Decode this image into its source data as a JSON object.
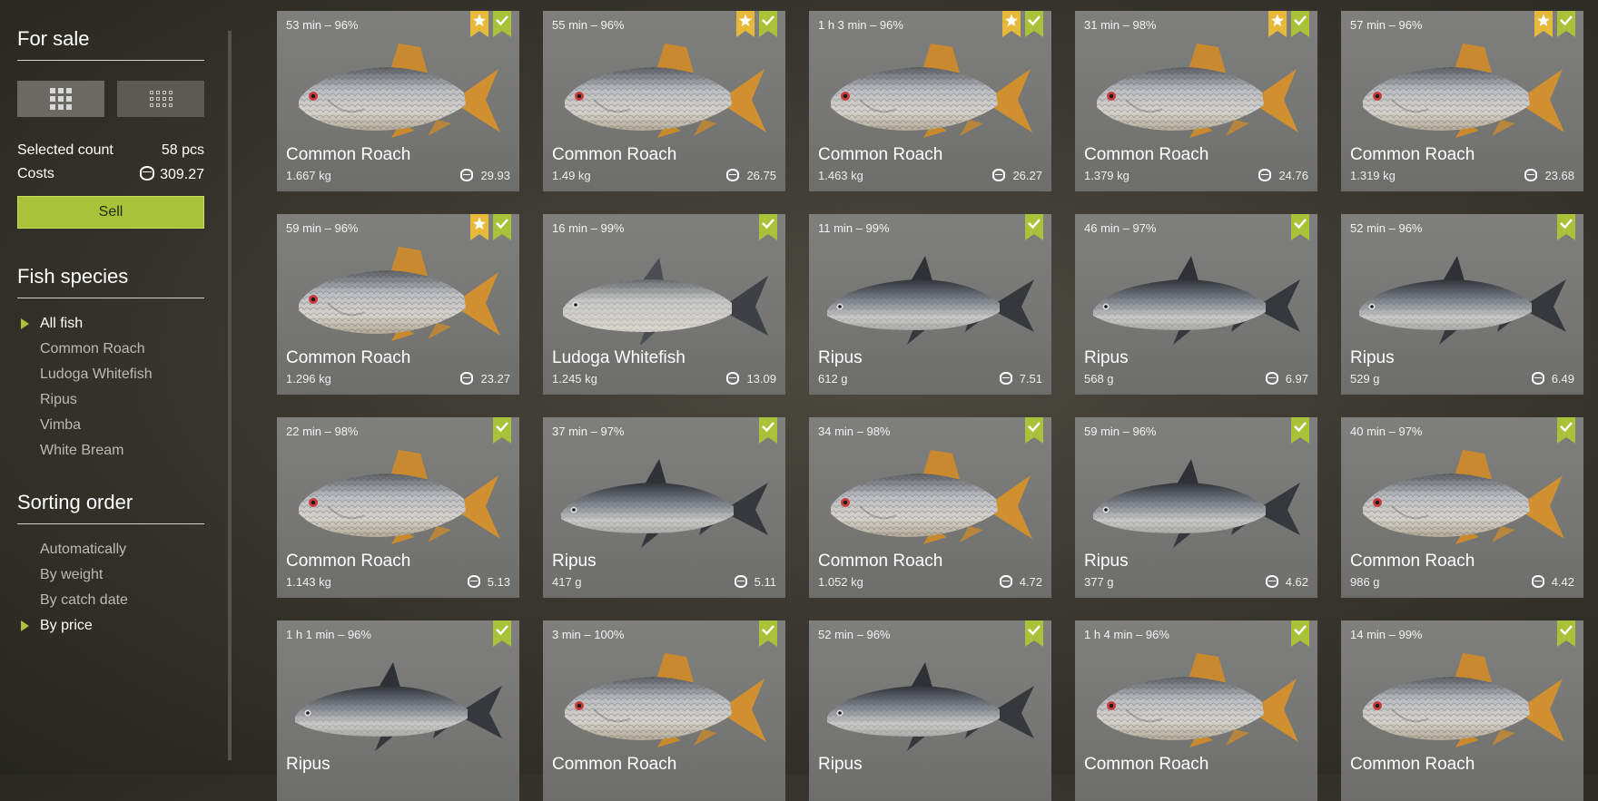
{
  "sidebar": {
    "for_sale_title": "For sale",
    "selected_count_label": "Selected count",
    "selected_count_value": "58 pcs",
    "costs_label": "Costs",
    "costs_value": "309.27",
    "sell_label": "Sell",
    "species_title": "Fish species",
    "species": [
      {
        "label": "All fish",
        "active": true
      },
      {
        "label": "Common Roach",
        "active": false
      },
      {
        "label": "Ludoga Whitefish",
        "active": false
      },
      {
        "label": "Ripus",
        "active": false
      },
      {
        "label": "Vimba",
        "active": false
      },
      {
        "label": "White Bream",
        "active": false
      }
    ],
    "sort_title": "Sorting order",
    "sorting": [
      {
        "label": "Automatically",
        "active": false
      },
      {
        "label": "By weight",
        "active": false
      },
      {
        "label": "By catch date",
        "active": false
      },
      {
        "label": "By price",
        "active": true
      }
    ]
  },
  "colors": {
    "accent": "#a9c23a",
    "star_ribbon": "#e6b93a",
    "card_bg": "#7a7a78"
  },
  "cards": [
    {
      "time": "53 min – 96%",
      "name": "Common Roach",
      "weight": "1.667 kg",
      "price": "29.93",
      "star": true,
      "fish": "roach"
    },
    {
      "time": "55 min – 96%",
      "name": "Common Roach",
      "weight": "1.49 kg",
      "price": "26.75",
      "star": true,
      "fish": "roach"
    },
    {
      "time": "1 h 3 min – 96%",
      "name": "Common Roach",
      "weight": "1.463 kg",
      "price": "26.27",
      "star": true,
      "fish": "roach"
    },
    {
      "time": "31 min – 98%",
      "name": "Common Roach",
      "weight": "1.379 kg",
      "price": "24.76",
      "star": true,
      "fish": "roach"
    },
    {
      "time": "57 min – 96%",
      "name": "Common Roach",
      "weight": "1.319 kg",
      "price": "23.68",
      "star": true,
      "fish": "roach"
    },
    {
      "time": "59 min – 96%",
      "name": "Common Roach",
      "weight": "1.296 kg",
      "price": "23.27",
      "star": true,
      "fish": "roach"
    },
    {
      "time": "16 min – 99%",
      "name": "Ludoga Whitefish",
      "weight": "1.245 kg",
      "price": "13.09",
      "star": false,
      "fish": "whitefish"
    },
    {
      "time": "11 min – 99%",
      "name": "Ripus",
      "weight": "612 g",
      "price": "7.51",
      "star": false,
      "fish": "ripus"
    },
    {
      "time": "46 min – 97%",
      "name": "Ripus",
      "weight": "568 g",
      "price": "6.97",
      "star": false,
      "fish": "ripus"
    },
    {
      "time": "52 min – 96%",
      "name": "Ripus",
      "weight": "529 g",
      "price": "6.49",
      "star": false,
      "fish": "ripus"
    },
    {
      "time": "22 min – 98%",
      "name": "Common Roach",
      "weight": "1.143 kg",
      "price": "5.13",
      "star": false,
      "fish": "roach"
    },
    {
      "time": "37 min – 97%",
      "name": "Ripus",
      "weight": "417 g",
      "price": "5.11",
      "star": false,
      "fish": "ripus"
    },
    {
      "time": "34 min – 98%",
      "name": "Common Roach",
      "weight": "1.052 kg",
      "price": "4.72",
      "star": false,
      "fish": "roach"
    },
    {
      "time": "59 min – 96%",
      "name": "Ripus",
      "weight": "377 g",
      "price": "4.62",
      "star": false,
      "fish": "ripus"
    },
    {
      "time": "40 min – 97%",
      "name": "Common Roach",
      "weight": "986 g",
      "price": "4.42",
      "star": false,
      "fish": "roach"
    },
    {
      "time": "1 h 1 min – 96%",
      "name": "Ripus",
      "weight": "",
      "price": "",
      "star": false,
      "fish": "ripus"
    },
    {
      "time": "3 min – 100%",
      "name": "Common Roach",
      "weight": "",
      "price": "",
      "star": false,
      "fish": "roach"
    },
    {
      "time": "52 min – 96%",
      "name": "Ripus",
      "weight": "",
      "price": "",
      "star": false,
      "fish": "ripus"
    },
    {
      "time": "1 h 4 min – 96%",
      "name": "Common Roach",
      "weight": "",
      "price": "",
      "star": false,
      "fish": "roach"
    },
    {
      "time": "14 min – 99%",
      "name": "Common Roach",
      "weight": "",
      "price": "",
      "star": false,
      "fish": "roach"
    }
  ]
}
